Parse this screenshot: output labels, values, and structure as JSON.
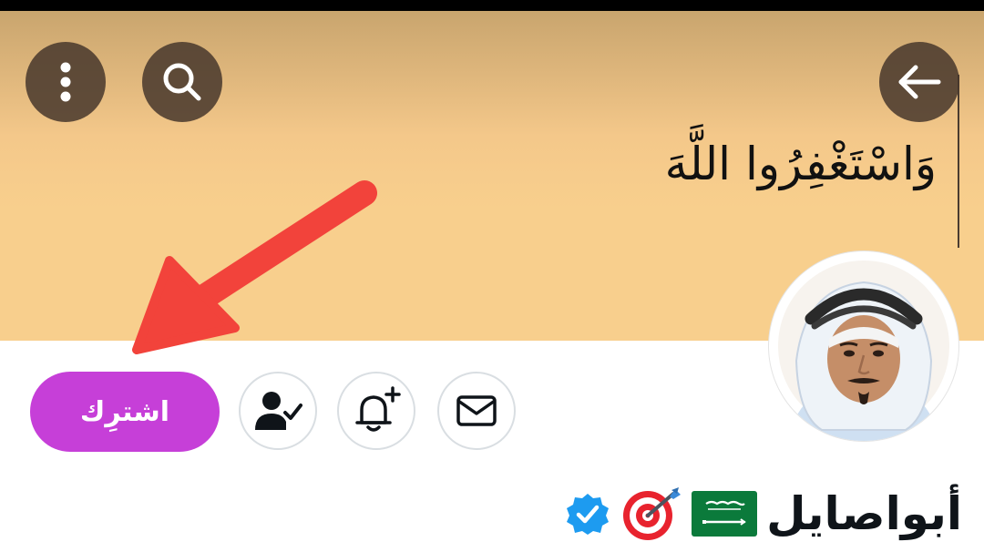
{
  "header": {
    "banner_text": "وَاسْتَغْفِرُوا اللَّهَ",
    "back_icon": "arrow-left-icon",
    "search_icon": "search-icon",
    "more_icon": "more-vertical-icon"
  },
  "actions": {
    "subscribe_label": "اشترِك",
    "follow_icon": "person-check-icon",
    "notify_icon": "bell-plus-icon",
    "message_icon": "envelope-icon"
  },
  "profile": {
    "name": "أبواصايل",
    "badges": [
      "saudi-flag",
      "target-dart",
      "verified-badge"
    ]
  },
  "colors": {
    "banner": "#f8cf8d",
    "subscribe_button": "#c63fd8",
    "verified": "#1d9bf0",
    "annotation_arrow": "#f2433b"
  }
}
